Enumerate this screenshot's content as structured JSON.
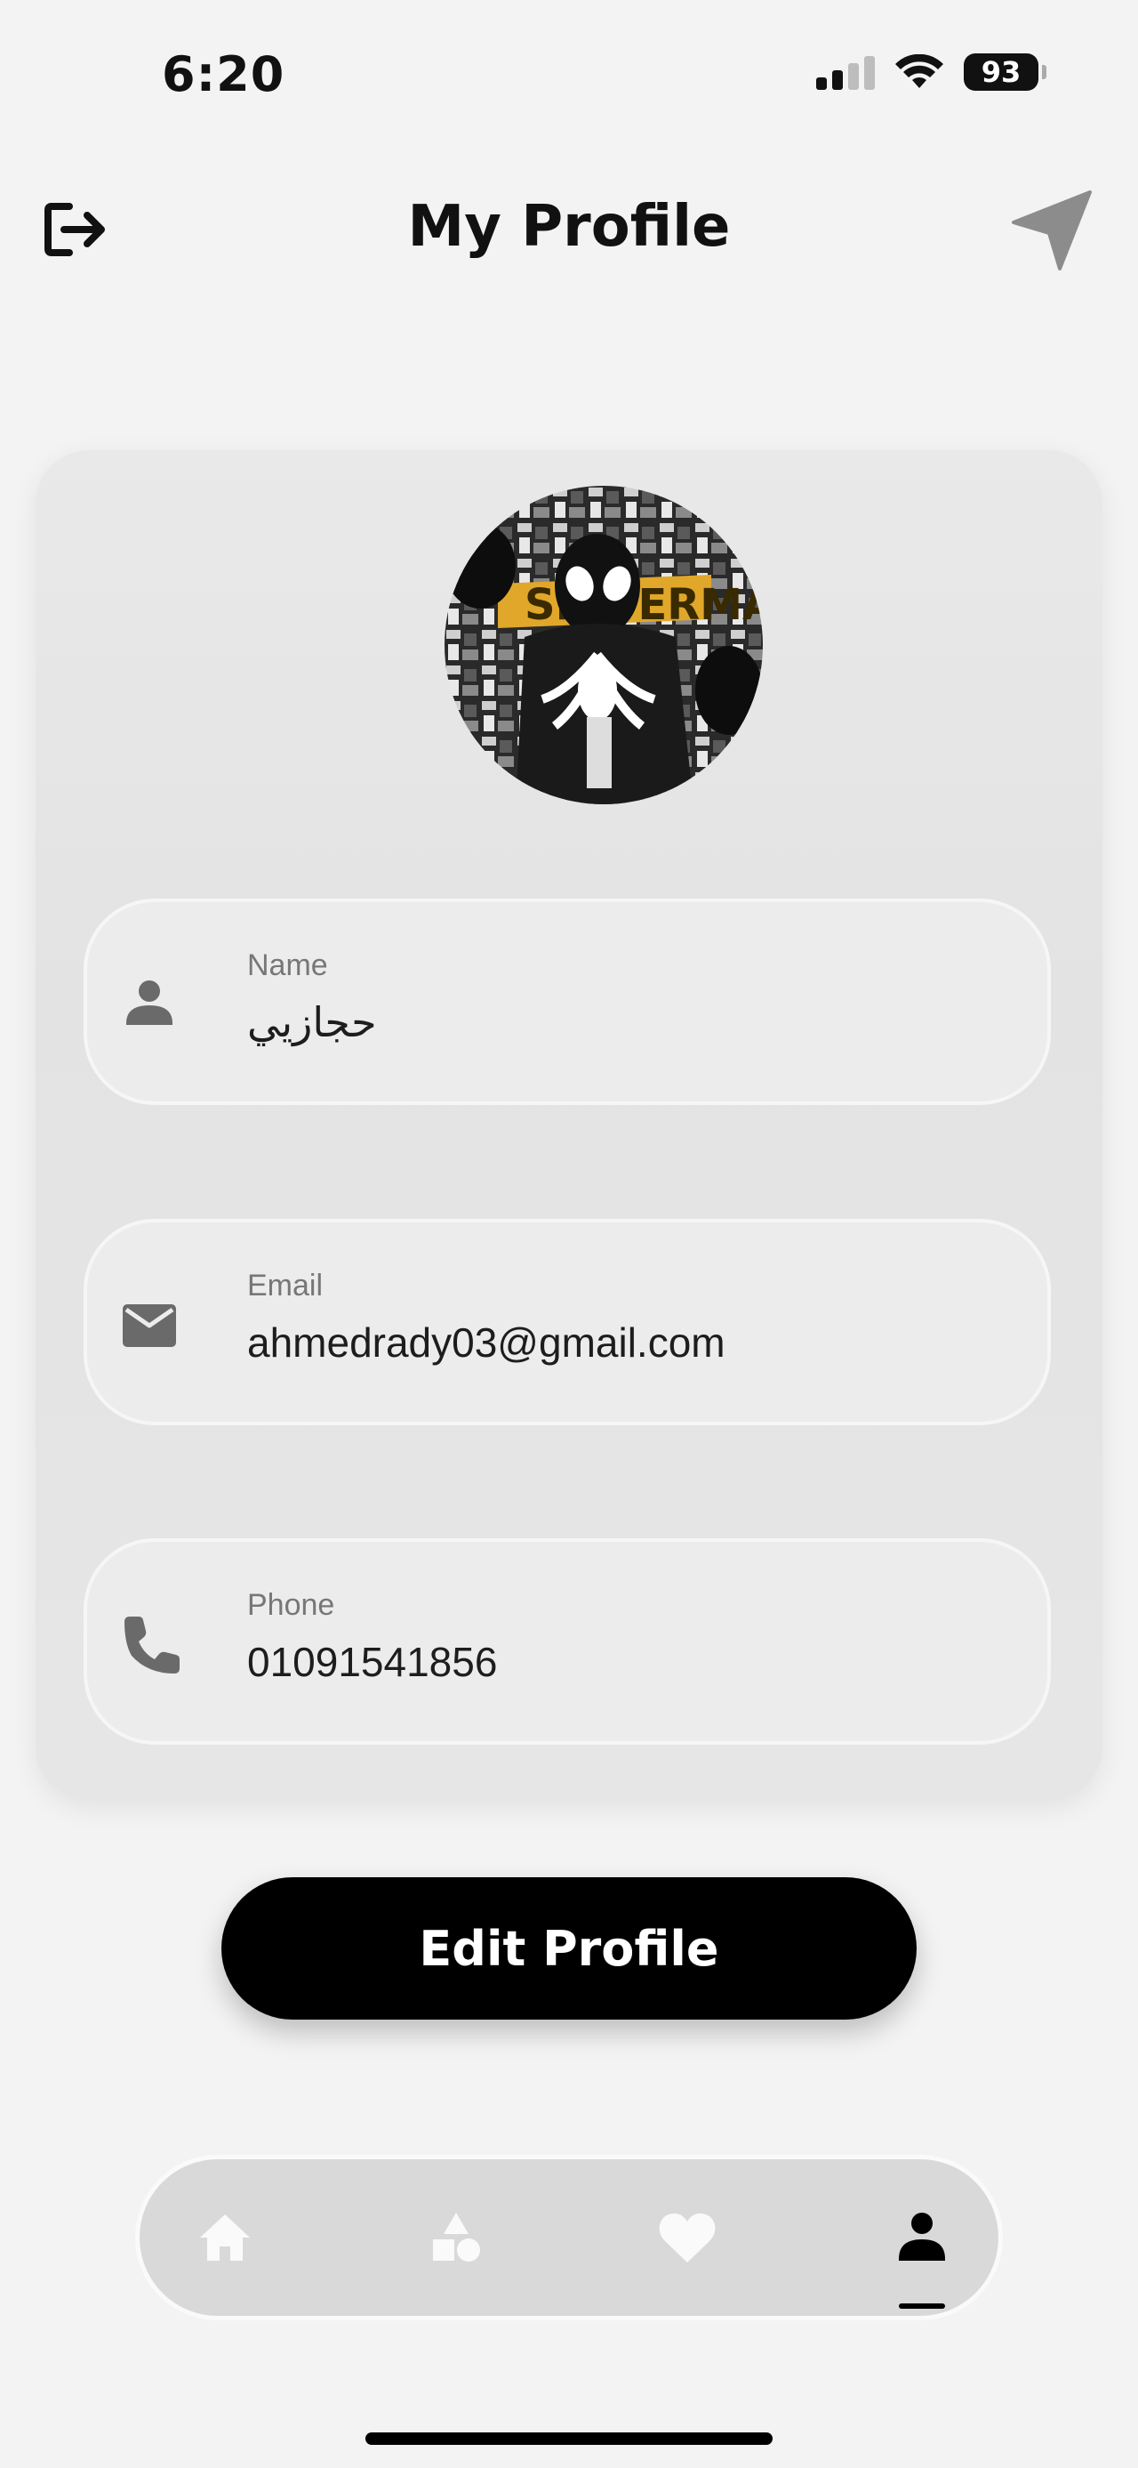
{
  "status_bar": {
    "time": "6:20",
    "battery": "93"
  },
  "header": {
    "title": "My Profile"
  },
  "profile": {
    "fields": [
      {
        "label": "Name",
        "value": "حجازيي"
      },
      {
        "label": "Email",
        "value": "ahmedrady03@gmail.com"
      },
      {
        "label": "Phone",
        "value": "01091541856"
      }
    ],
    "edit_label": "Edit Profile"
  },
  "nav": {
    "items": [
      {
        "icon": "home-icon",
        "active": false
      },
      {
        "icon": "categories-icon",
        "active": false
      },
      {
        "icon": "heart-icon",
        "active": false
      },
      {
        "icon": "person-icon",
        "active": true
      }
    ]
  }
}
